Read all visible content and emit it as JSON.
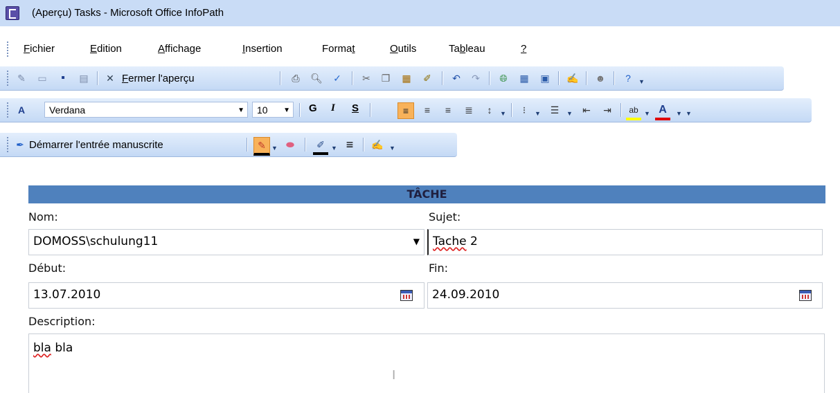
{
  "window": {
    "title": "(Aperçu) Tasks - Microsoft Office InfoPath"
  },
  "menu": {
    "items": [
      {
        "label": "Fichier",
        "key": "F",
        "rest": "ichier"
      },
      {
        "label": "Edition",
        "key": "E",
        "rest": "dition"
      },
      {
        "label": "Affichage",
        "key": "A",
        "rest": "ffichage"
      },
      {
        "label": "Insertion",
        "key": "I",
        "rest": "nsertion"
      },
      {
        "label": "Format",
        "pre": "Forma",
        "key": "t",
        "rest": ""
      },
      {
        "label": "Outils",
        "key": "O",
        "rest": "utils"
      },
      {
        "label": "Tableau",
        "pre": "Ta",
        "key": "b",
        "rest": "leau"
      },
      {
        "label": "?",
        "key": "?",
        "rest": ""
      }
    ]
  },
  "toolbar_standard": {
    "close_preview_label": "Fermer l'aperçu",
    "close_preview_key": "F",
    "close_preview_rest": "ermer l'aperçu"
  },
  "toolbar_format": {
    "font_name": "Verdana",
    "font_size": "10",
    "bold": "G",
    "italic": "I",
    "strike": "S",
    "font_color_letter": "A",
    "highlight_letter": "ab"
  },
  "toolbar_ink": {
    "start_ink_label": "Démarrer l'entrée manuscrite"
  },
  "form": {
    "title": "TÂCHE",
    "name_label": "Nom:",
    "name_value": "DOMOSS\\schulung11",
    "subject_label": "Sujet:",
    "subject_value_word": "Tache",
    "subject_value_rest": " 2",
    "start_label": "Début:",
    "start_value": "13.07.2010",
    "end_label": "Fin:",
    "end_value": "24.09.2010",
    "description_label": "Description:",
    "description_word": "bla",
    "description_rest": " bla"
  },
  "colors": {
    "title_bar": "#c9dcf6",
    "toolbar": "#d4e4f8",
    "form_header": "#4f81bd",
    "accent_red": "#e00000",
    "highlight_yellow": "#ffff00"
  }
}
